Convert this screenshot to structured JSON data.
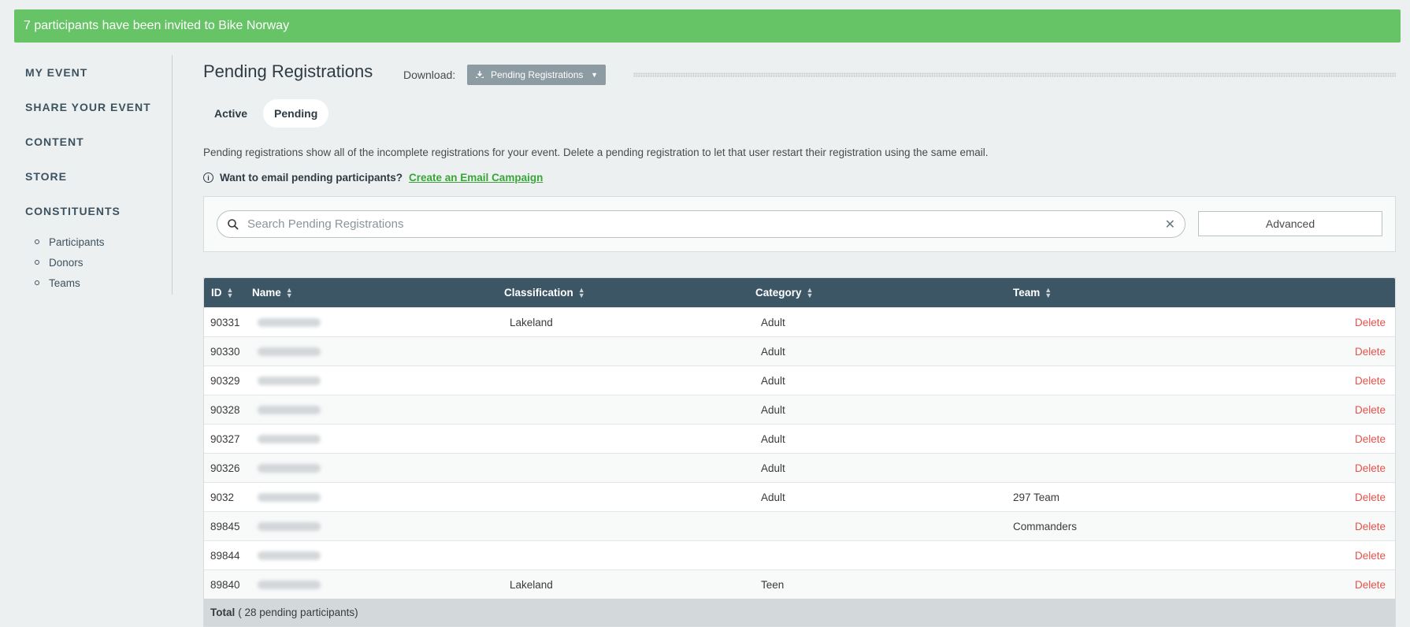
{
  "banner": {
    "message": "7 participants have been invited to Bike Norway"
  },
  "sidebar": {
    "items": [
      {
        "label": "MY EVENT"
      },
      {
        "label": "SHARE YOUR EVENT"
      },
      {
        "label": "CONTENT"
      },
      {
        "label": "STORE"
      },
      {
        "label": "CONSTITUENTS"
      }
    ],
    "sub_items": [
      {
        "label": "Participants"
      },
      {
        "label": "Donors"
      },
      {
        "label": "Teams"
      }
    ]
  },
  "header": {
    "title": "Pending Registrations",
    "download_label": "Download:",
    "download_button": "Pending Registrations"
  },
  "tabs": [
    {
      "label": "Active",
      "active": false
    },
    {
      "label": "Pending",
      "active": true
    }
  ],
  "description": "Pending registrations show all of the incomplete registrations for your event. Delete a pending registration to let that user restart their registration using the same email.",
  "info": {
    "prompt": "Want to email pending participants?",
    "link": "Create an Email Campaign"
  },
  "search": {
    "placeholder": "Search Pending Registrations",
    "value": "",
    "advanced_label": "Advanced"
  },
  "table": {
    "columns": [
      "ID",
      "Name",
      "Classification",
      "Category",
      "Team"
    ],
    "delete_label": "Delete",
    "rows": [
      {
        "id": "90331",
        "classification": "Lakeland",
        "category": "Adult",
        "team": ""
      },
      {
        "id": "90330",
        "classification": "",
        "category": "Adult",
        "team": ""
      },
      {
        "id": "90329",
        "classification": "",
        "category": "Adult",
        "team": ""
      },
      {
        "id": "90328",
        "classification": "",
        "category": "Adult",
        "team": ""
      },
      {
        "id": "90327",
        "classification": "",
        "category": "Adult",
        "team": ""
      },
      {
        "id": "90326",
        "classification": "",
        "category": "Adult",
        "team": ""
      },
      {
        "id": "9032",
        "classification": "",
        "category": "Adult",
        "team": "297 Team"
      },
      {
        "id": "89845",
        "classification": "",
        "category": "",
        "team": "Commanders"
      },
      {
        "id": "89844",
        "classification": "",
        "category": "",
        "team": ""
      },
      {
        "id": "89840",
        "classification": "Lakeland",
        "category": "Teen",
        "team": ""
      }
    ],
    "footer_label": "Total",
    "footer_count": "( 28 pending participants)"
  },
  "colors": {
    "banner": "#66c366",
    "table_header": "#3d5666",
    "delete": "#e4524a",
    "link": "#3aa43a"
  }
}
